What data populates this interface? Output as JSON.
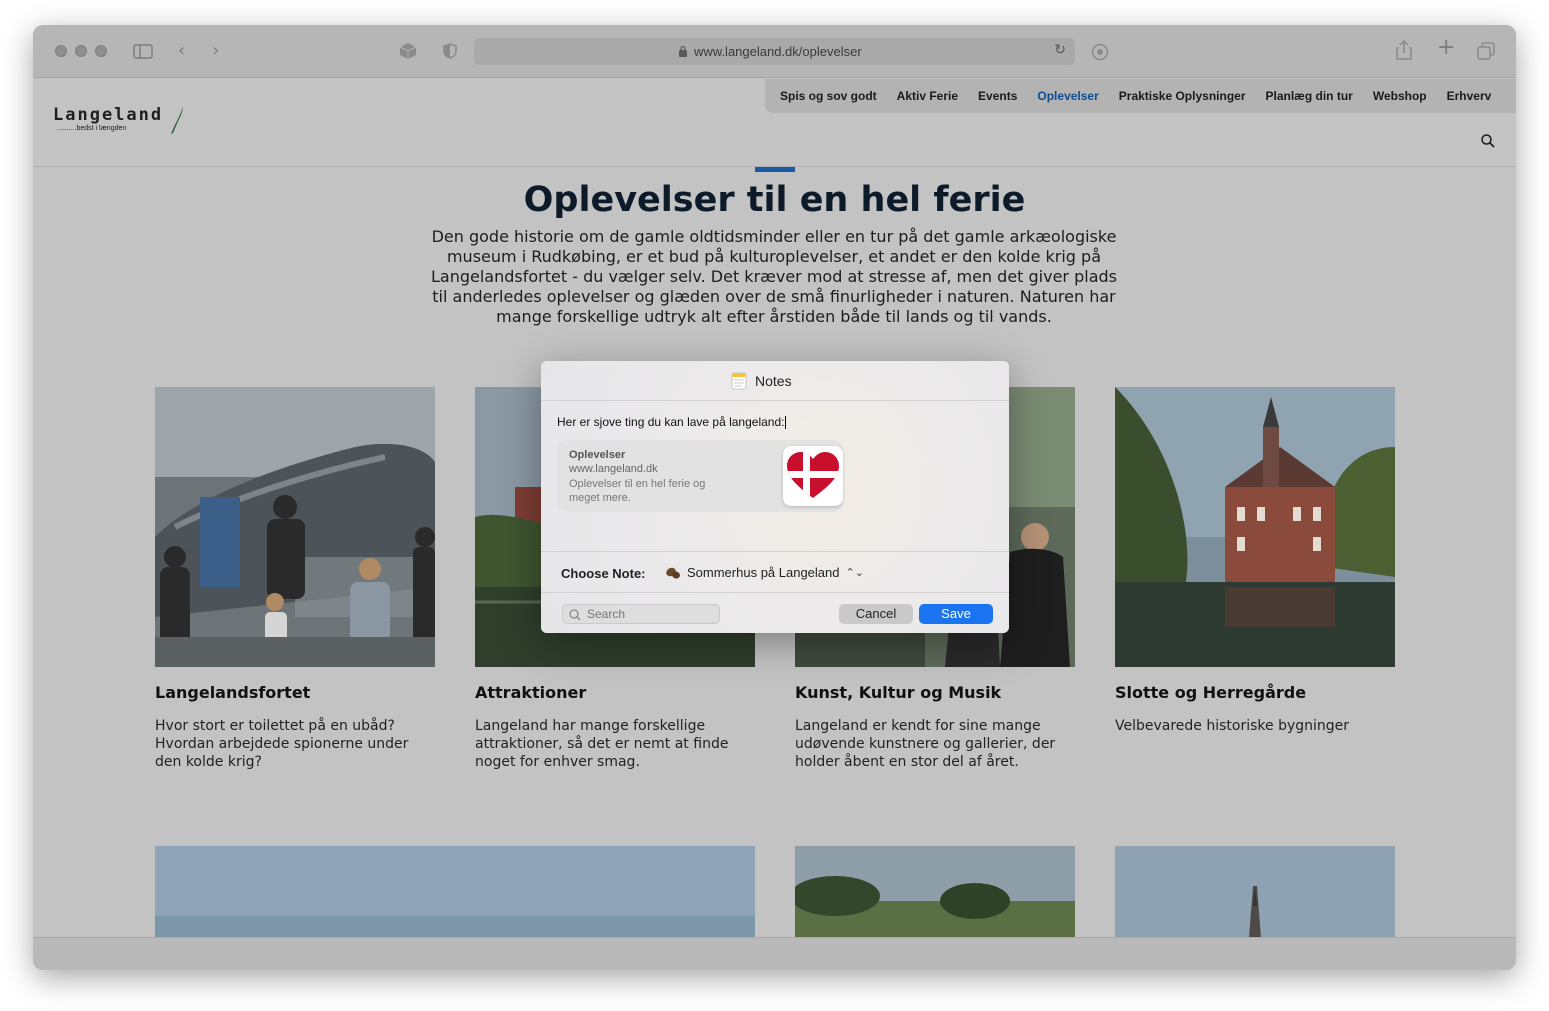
{
  "browser": {
    "url": "www.langeland.dk/oplevelser"
  },
  "site": {
    "logo_word": "Langeland",
    "logo_tagline": "..........bedst i længden",
    "nav": [
      "Spis og sov godt",
      "Aktiv Ferie",
      "Events",
      "Oplevelser",
      "Praktiske Oplysninger",
      "Planlæg din tur",
      "Webshop",
      "Erhverv"
    ],
    "nav_active": "Oplevelser",
    "accent_color": "#1b5aa3"
  },
  "hero": {
    "title": "Oplevelser til en hel ferie",
    "text": "Den gode historie om de gamle oldtidsminder eller en tur på det gamle arkæologiske museum i Rudkøbing, er et bud på kulturoplevelser, et andet er den kolde krig på Langelandsfortet - du vælger selv. Det kræver mod at stresse af, men det giver plads til anderledes oplevelser og glæden over de små finurligheder i naturen. Naturen har mange forskellige udtryk alt efter årstiden både til lands og til vands."
  },
  "cards": [
    {
      "title": "Langelandsfortet",
      "text": "Hvor stort er toilettet på en ubåd? Hvordan arbejdede spionerne under den kolde krig?"
    },
    {
      "title": "Attraktioner",
      "text": "Langeland har mange forskellige attraktioner, så det er nemt at finde noget for enhver smag."
    },
    {
      "title": "Kunst, Kultur og Musik",
      "text": "Langeland er kendt for sine mange udøvende kunstnere og gallerier, der holder åbent en stor del af året."
    },
    {
      "title": "Slotte og Herregårde",
      "text": "Velbevarede historiske bygninger"
    }
  ],
  "notes_dialog": {
    "title": "Notes",
    "note_text": "Her er sjove ting du kan lave på langeland:",
    "link_card": {
      "title": "Oplevelser",
      "url": "www.langeland.dk",
      "description": "Oplevelser til en hel ferie og meget mere."
    },
    "choose_label": "Choose Note:",
    "choose_value": "Sommerhus på Langeland",
    "search_placeholder": "Search",
    "cancel_label": "Cancel",
    "save_label": "Save",
    "save_color": "#1a73f0"
  }
}
